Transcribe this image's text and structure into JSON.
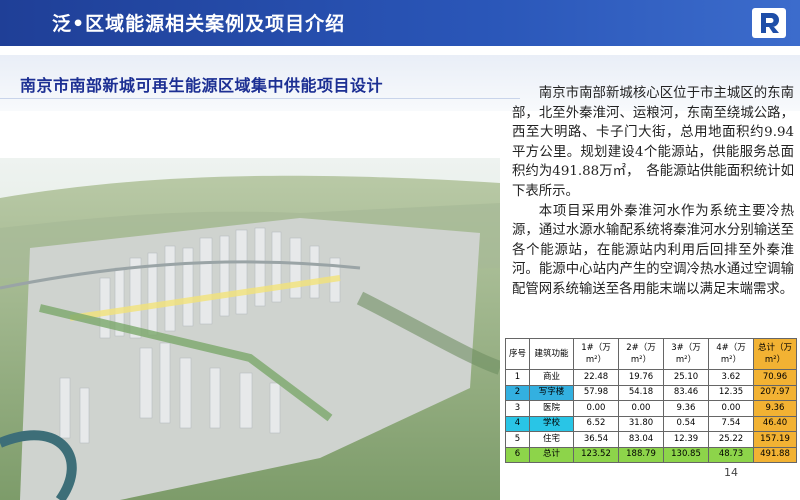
{
  "header": {
    "title": "泛•区域能源相关案例及项目介绍",
    "logo_icon": "company-logo-icon",
    "bg_color": "#2448a6"
  },
  "subtitle": "南京市南部新城可再生能源区域集中供能项目设计",
  "description": {
    "p1": "南京市南部新城核心区位于市主城区的东南部，北至外秦淮河、运粮河，东南至绕城公路，西至大明路、卡子门大街，总用地面积约9.94平方公里。规划建设4个能源站，供能服务总面积约为491.88万㎡，　各能源站供能面积统计如下表所示。",
    "p2": "本项目采用外秦淮河水作为系统主要冷热源，通过水源水输配系统将秦淮河水分别输送至各个能源站，在能源站内利用后回排至外秦淮河。能源中心站内产生的空调冷热水通过空调输配管网系统输送至各用能末端以满足末端需求。"
  },
  "table": {
    "headers": [
      "序号",
      "建筑功能",
      "1#（万m²）",
      "2#（万m²）",
      "3#（万m²）",
      "4#（万m²）",
      "总计（万m²）"
    ],
    "rows": [
      [
        "1",
        "商业",
        "22.48",
        "19.76",
        "25.10",
        "3.62",
        "70.96"
      ],
      [
        "2",
        "写字楼",
        "57.98",
        "54.18",
        "83.46",
        "12.35",
        "207.97"
      ],
      [
        "3",
        "医院",
        "0.00",
        "0.00",
        "9.36",
        "0.00",
        "9.36"
      ],
      [
        "4",
        "学校",
        "6.52",
        "31.80",
        "0.54",
        "7.54",
        "46.40"
      ],
      [
        "5",
        "住宅",
        "36.54",
        "83.04",
        "12.39",
        "25.22",
        "157.19"
      ],
      [
        "6",
        "总计",
        "123.52",
        "188.79",
        "130.85",
        "48.73",
        "491.88"
      ]
    ],
    "row_colors": [
      "#ffffff",
      "#33b0e0",
      "#ffffff",
      "#29c5e6",
      "#ffffff",
      "#8dd44a"
    ],
    "total_col_color": "#f2b233"
  },
  "page_number": "14"
}
